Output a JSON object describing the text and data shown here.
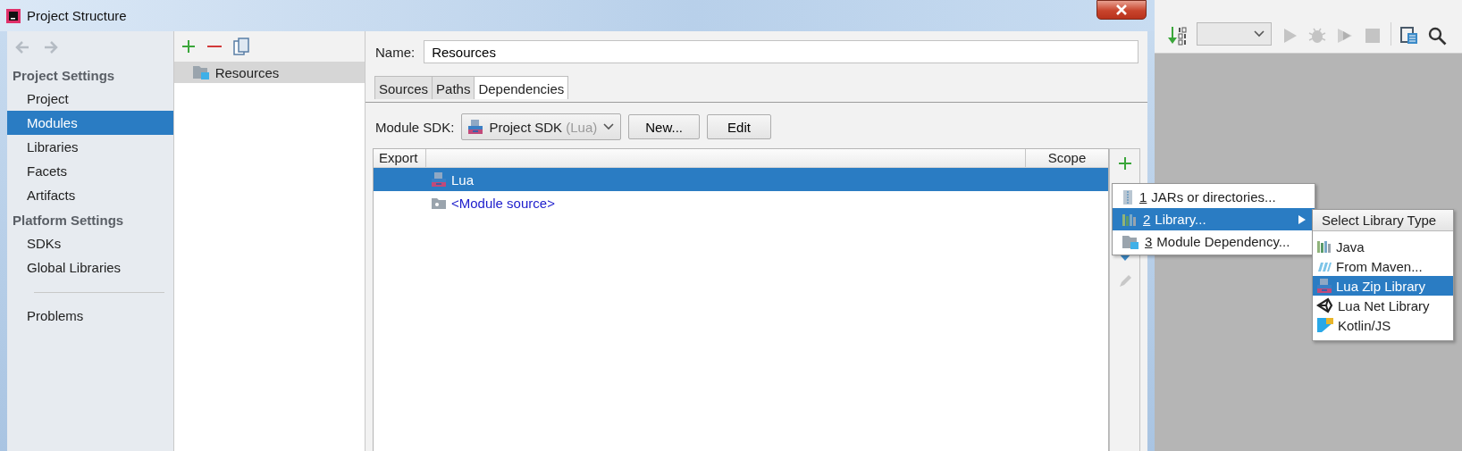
{
  "window": {
    "title": "Project Structure"
  },
  "sidebar": {
    "sections": [
      {
        "title": "Project Settings",
        "items": [
          {
            "label": "Project",
            "selected": false
          },
          {
            "label": "Modules",
            "selected": true
          },
          {
            "label": "Libraries",
            "selected": false
          },
          {
            "label": "Facets",
            "selected": false
          },
          {
            "label": "Artifacts",
            "selected": false
          }
        ]
      },
      {
        "title": "Platform Settings",
        "items": [
          {
            "label": "SDKs",
            "selected": false
          },
          {
            "label": "Global Libraries",
            "selected": false
          }
        ]
      }
    ],
    "bottom_items": [
      {
        "label": "Problems",
        "selected": false
      }
    ]
  },
  "modules": {
    "items": [
      {
        "label": "Resources",
        "selected": true
      }
    ]
  },
  "name_field": {
    "label": "Name:",
    "value": "Resources"
  },
  "tabs": [
    {
      "label": "Sources",
      "selected": false
    },
    {
      "label": "Paths",
      "selected": false
    },
    {
      "label": "Dependencies",
      "selected": true
    }
  ],
  "sdk": {
    "label": "Module SDK:",
    "value": "Project SDK",
    "hint": "(Lua)",
    "buttons": [
      "New...",
      "Edit"
    ]
  },
  "table": {
    "columns": [
      "Export",
      "Scope"
    ],
    "rows": [
      {
        "name": "Lua",
        "kind": "sdk",
        "selected": true
      },
      {
        "name": "<Module source>",
        "kind": "source",
        "selected": false
      }
    ]
  },
  "add_menu": {
    "items": [
      {
        "mnemonic": "1",
        "label": "JARs or directories...",
        "kind": "jar",
        "selected": false,
        "submenu": false
      },
      {
        "mnemonic": "2",
        "label": "Library...",
        "kind": "library",
        "selected": true,
        "submenu": true
      },
      {
        "mnemonic": "3",
        "label": "Module Dependency...",
        "kind": "module",
        "selected": false,
        "submenu": false
      }
    ]
  },
  "library_menu": {
    "title": "Select Library Type",
    "items": [
      {
        "label": "Java",
        "kind": "library",
        "selected": false
      },
      {
        "label": "From Maven...",
        "kind": "maven",
        "selected": false
      },
      {
        "label": "Lua Zip Library",
        "kind": "sdk",
        "selected": true
      },
      {
        "label": "Lua Net Library",
        "kind": "unity",
        "selected": false
      },
      {
        "label": "Kotlin/JS",
        "kind": "kotlin",
        "selected": false
      }
    ]
  }
}
